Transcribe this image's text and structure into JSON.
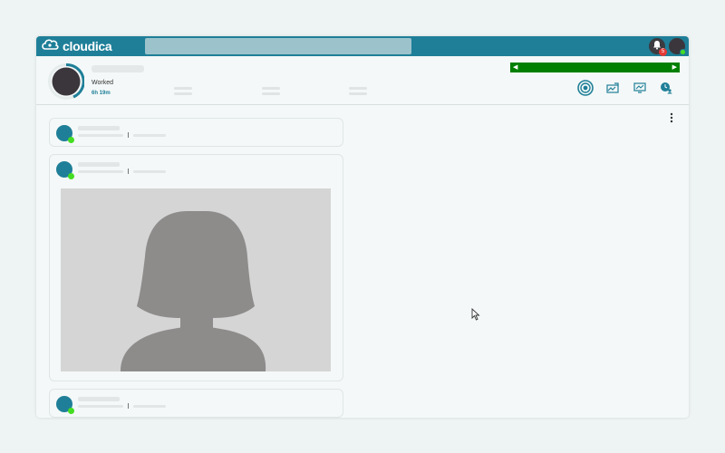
{
  "app": {
    "brand": "cloudica",
    "search": {
      "value": "",
      "placeholder": ""
    },
    "notifications": {
      "count": "5"
    }
  },
  "colors": {
    "brand": "#1f7f98",
    "search_bg": "#9cc3cc",
    "status_online": "#44dd22",
    "progress_bar": "#008000",
    "badge": "#e53935"
  },
  "header": {
    "worked_label": "Worked",
    "worked_time": "6h 19m"
  },
  "icons": {
    "logo": "cloud-logo-icon",
    "bell": "bell-icon",
    "broadcast": "broadcast-icon",
    "activity": "activity-icon",
    "screen": "screen-icon",
    "timer": "clock-user-icon",
    "more": "more-vertical-icon",
    "cursor": "mouse-cursor-icon"
  },
  "feed": {
    "cards": [
      {
        "kind": "compact"
      },
      {
        "kind": "photo",
        "photo_icon": "person-placeholder-icon"
      },
      {
        "kind": "compact"
      }
    ]
  }
}
